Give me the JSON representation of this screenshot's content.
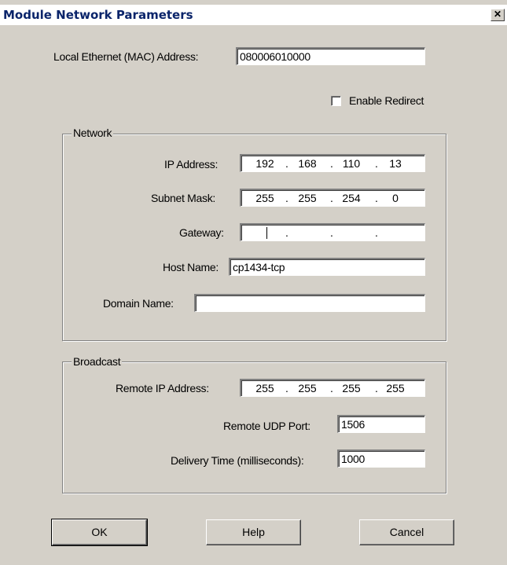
{
  "window": {
    "title": "Module Network Parameters",
    "close_glyph": "✕"
  },
  "mac": {
    "label": "Local Ethernet (MAC) Address:",
    "value": "080006010000"
  },
  "redirect": {
    "label": "Enable Redirect",
    "checked": false
  },
  "network": {
    "legend": "Network",
    "ip_label": "IP Address:",
    "ip": [
      "192",
      "168",
      "110",
      "13"
    ],
    "mask_label": "Subnet Mask:",
    "mask": [
      "255",
      "255",
      "254",
      "0"
    ],
    "gateway_label": "Gateway:",
    "gateway": [
      "",
      "",
      "",
      ""
    ],
    "host_label": "Host Name:",
    "host": "cp1434-tcp",
    "domain_label": "Domain Name:",
    "domain": ""
  },
  "broadcast": {
    "legend": "Broadcast",
    "remote_ip_label": "Remote IP Address:",
    "remote_ip": [
      "255",
      "255",
      "255",
      "255"
    ],
    "udp_label": "Remote UDP Port:",
    "udp": "1506",
    "delivery_label": "Delivery Time (milliseconds):",
    "delivery": "1000"
  },
  "buttons": {
    "ok": "OK",
    "help": "Help",
    "cancel": "Cancel"
  },
  "ip_separator": "."
}
